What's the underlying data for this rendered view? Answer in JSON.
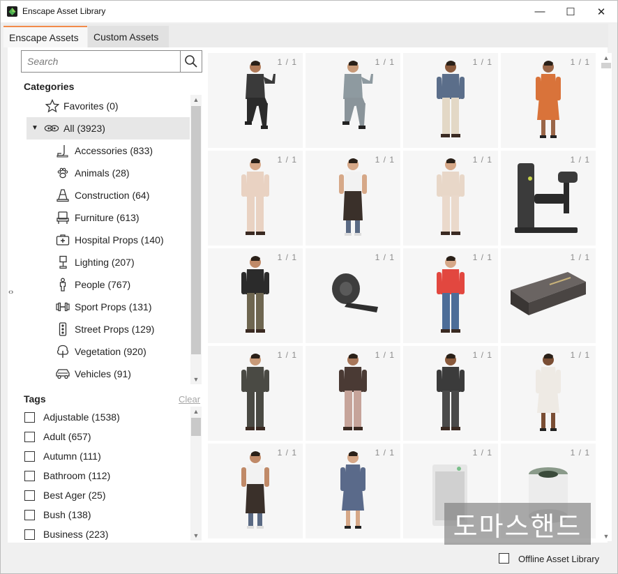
{
  "window": {
    "title": "Enscape Asset Library",
    "controls": {
      "minimize": "—",
      "maximize": "☐",
      "close": "✕"
    }
  },
  "tabs": [
    {
      "label": "Enscape Assets",
      "active": true
    },
    {
      "label": "Custom Assets",
      "active": false
    }
  ],
  "search": {
    "placeholder": "Search",
    "value": ""
  },
  "categories": {
    "heading": "Categories",
    "items": [
      {
        "label": "Favorites (0)",
        "icon": "star-icon"
      },
      {
        "label": "All (3923)",
        "icon": "all-icon",
        "selected": true,
        "expanded": true
      },
      {
        "label": "Accessories (833)",
        "icon": "accessories-icon"
      },
      {
        "label": "Animals (28)",
        "icon": "paw-icon"
      },
      {
        "label": "Construction (64)",
        "icon": "traffic-cone-icon"
      },
      {
        "label": "Furniture (613)",
        "icon": "chair-icon"
      },
      {
        "label": "Hospital Props (140)",
        "icon": "medical-case-icon"
      },
      {
        "label": "Lighting (207)",
        "icon": "lamp-icon"
      },
      {
        "label": "People (767)",
        "icon": "person-icon"
      },
      {
        "label": "Sport Props (131)",
        "icon": "dumbbell-icon"
      },
      {
        "label": "Street Props (129)",
        "icon": "traffic-light-icon"
      },
      {
        "label": "Vegetation (920)",
        "icon": "tree-icon"
      },
      {
        "label": "Vehicles (91)",
        "icon": "car-icon"
      }
    ]
  },
  "tags": {
    "heading": "Tags",
    "clear_label": "Clear",
    "items": [
      {
        "label": "Adjustable (1538)",
        "checked": false
      },
      {
        "label": "Adult (657)",
        "checked": false
      },
      {
        "label": "Autumn (111)",
        "checked": false
      },
      {
        "label": "Bathroom (112)",
        "checked": false
      },
      {
        "label": "Best Ager (25)",
        "checked": false
      },
      {
        "label": "Bush (138)",
        "checked": false
      },
      {
        "label": "Business (223)",
        "checked": false
      }
    ]
  },
  "assets": {
    "tiles": [
      {
        "count": "1 / 1",
        "kind": "person",
        "top": "#3a3a3a",
        "bottom": "#2b2b2b",
        "skin": "#b07a58",
        "pose": "sit"
      },
      {
        "count": "1 / 1",
        "kind": "person",
        "top": "#8e9aa0",
        "bottom": "#8a949a",
        "skin": "#c89a78",
        "pose": "sit"
      },
      {
        "count": "1 / 1",
        "kind": "person",
        "top": "#5b6e8a",
        "bottom": "#e3d8c6",
        "skin": "#8a5a3c",
        "pose": "stand"
      },
      {
        "count": "1 / 1",
        "kind": "person",
        "top": "#d9733a",
        "bottom": "#d9733a",
        "skin": "#9a6648",
        "pose": "dress"
      },
      {
        "count": "1 / 1",
        "kind": "person",
        "top": "#e9d2c2",
        "bottom": "#e9d2c2",
        "skin": "#d6a888",
        "pose": "stand"
      },
      {
        "count": "1 / 1",
        "kind": "person",
        "top": "#f2f2f2",
        "bottom": "#3a302a",
        "skin": "#d6a888",
        "pose": "apron"
      },
      {
        "count": "1 / 1",
        "kind": "person",
        "top": "#e8d7c8",
        "bottom": "#ead9cb",
        "skin": "#d6a888",
        "pose": "stand"
      },
      {
        "count": "1 / 1",
        "kind": "machine",
        "top": "#3b3b3b",
        "bottom": "#2a2a2a"
      },
      {
        "count": "1 / 1",
        "kind": "person",
        "top": "#2b2b2b",
        "bottom": "#6e6650",
        "skin": "#c08a68",
        "pose": "stand"
      },
      {
        "count": "1 / 1",
        "kind": "tape",
        "top": "#3d3d3d",
        "bottom": "#2e2e2e"
      },
      {
        "count": "1 / 1",
        "kind": "person",
        "top": "#e2473f",
        "bottom": "#4d6d98",
        "skin": "#d6a888",
        "pose": "walk"
      },
      {
        "count": "1 / 1",
        "kind": "step",
        "top": "#4a4543",
        "bottom": "#3a3634"
      },
      {
        "count": "1 / 1",
        "kind": "person",
        "top": "#4a4a44",
        "bottom": "#4a4a44",
        "skin": "#c89a78",
        "pose": "stand"
      },
      {
        "count": "1 / 1",
        "kind": "person",
        "top": "#4a3a34",
        "bottom": "#c6a49a",
        "skin": "#a8775a",
        "pose": "stand"
      },
      {
        "count": "1 / 1",
        "kind": "person",
        "top": "#3b3b3b",
        "bottom": "#4a4a4a",
        "skin": "#8a5a3c",
        "pose": "stand"
      },
      {
        "count": "1 / 1",
        "kind": "person",
        "top": "#eeeae4",
        "bottom": "#c0a090",
        "skin": "#7a4e34",
        "pose": "dress"
      },
      {
        "count": "1 / 1",
        "kind": "person",
        "top": "#f2f2f2",
        "bottom": "#3a302a",
        "skin": "#c08a68",
        "pose": "apron"
      },
      {
        "count": "1 / 1",
        "kind": "person",
        "top": "#5a6a8a",
        "bottom": "#5a6a8a",
        "skin": "#d6a888",
        "pose": "dress"
      },
      {
        "count": "1 / 1",
        "kind": "purifier",
        "top": "#e6e6e6",
        "bottom": "#d0d0d0"
      },
      {
        "count": "1 / 1",
        "kind": "fan",
        "top": "#ececec",
        "bottom": "#d4d4d4"
      }
    ]
  },
  "watermark": {
    "text": "도마스핸드"
  },
  "footer": {
    "offline_label": "Offline Asset Library",
    "offline_checked": false
  },
  "colors": {
    "active_tab_accent": "#f28b4a",
    "selected_row": "#e7e7e7",
    "tile_bg": "#f6f6f6"
  }
}
